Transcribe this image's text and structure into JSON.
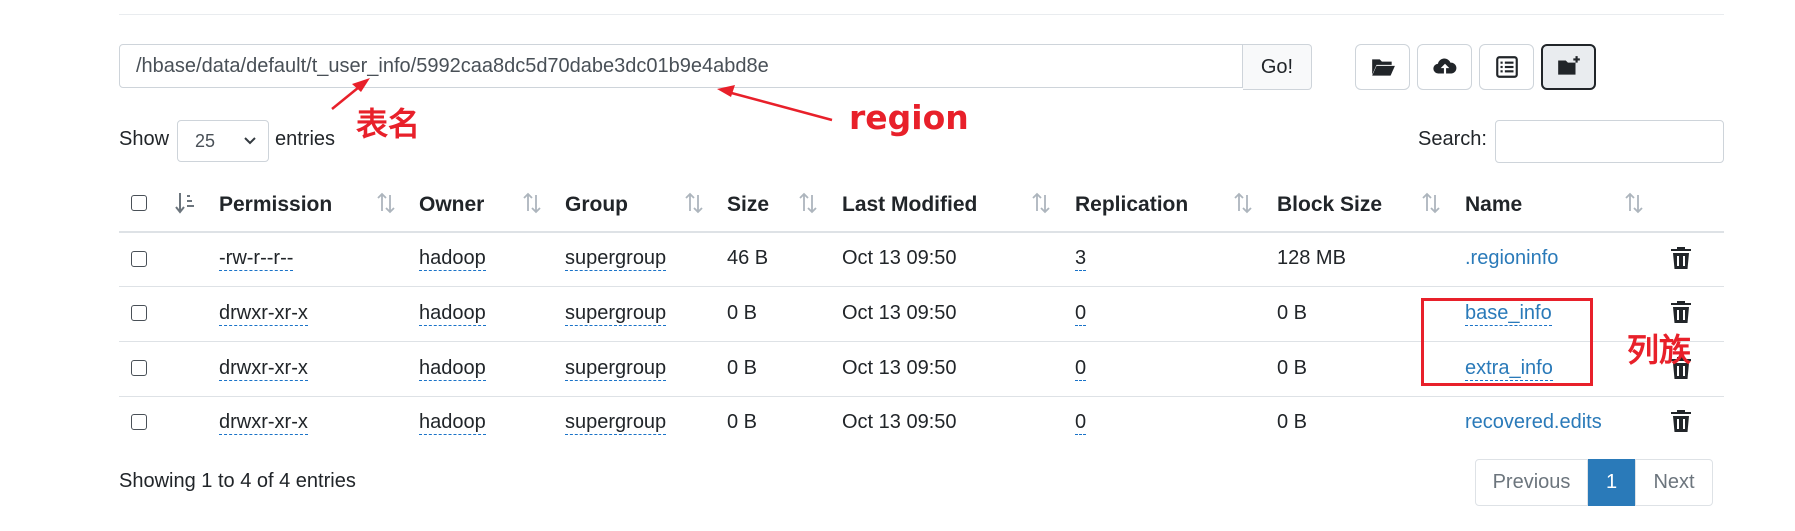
{
  "path": {
    "value": "/hbase/data/default/t_user_info/5992caa8dc5d70dabe3dc01b9e4abd8e",
    "go_label": "Go!"
  },
  "toolbar": {
    "icons": [
      "folder-open-icon",
      "cloud-upload-icon",
      "list-icon",
      "paste-folder-icon"
    ]
  },
  "length": {
    "show_label": "Show",
    "value": "25",
    "entries_label": "entries"
  },
  "search": {
    "label": "Search:"
  },
  "table": {
    "headers": {
      "permission": "Permission",
      "owner": "Owner",
      "group": "Group",
      "size": "Size",
      "modified": "Last Modified",
      "replication": "Replication",
      "block_size": "Block Size",
      "name": "Name"
    },
    "rows": [
      {
        "permission": "-rw-r--r--",
        "owner": "hadoop",
        "group": "supergroup",
        "size": "46 B",
        "modified": "Oct 13 09:50",
        "replication": "3",
        "block_size": "128 MB",
        "name": ".regioninfo"
      },
      {
        "permission": "drwxr-xr-x",
        "owner": "hadoop",
        "group": "supergroup",
        "size": "0 B",
        "modified": "Oct 13 09:50",
        "replication": "0",
        "block_size": "0 B",
        "name": "base_info"
      },
      {
        "permission": "drwxr-xr-x",
        "owner": "hadoop",
        "group": "supergroup",
        "size": "0 B",
        "modified": "Oct 13 09:50",
        "replication": "0",
        "block_size": "0 B",
        "name": "extra_info"
      },
      {
        "permission": "drwxr-xr-x",
        "owner": "hadoop",
        "group": "supergroup",
        "size": "0 B",
        "modified": "Oct 13 09:50",
        "replication": "0",
        "block_size": "0 B",
        "name": "recovered.edits"
      }
    ]
  },
  "footer": {
    "info": "Showing 1 to 4 of 4 entries",
    "previous": "Previous",
    "current": "1",
    "next": "Next"
  },
  "annotations": {
    "table_name": "表名",
    "region": "region",
    "column_family": "列族"
  },
  "colors": {
    "annotation": "#e8202a",
    "link": "#2a7ab9",
    "pager_active": "#2a7ab9"
  }
}
